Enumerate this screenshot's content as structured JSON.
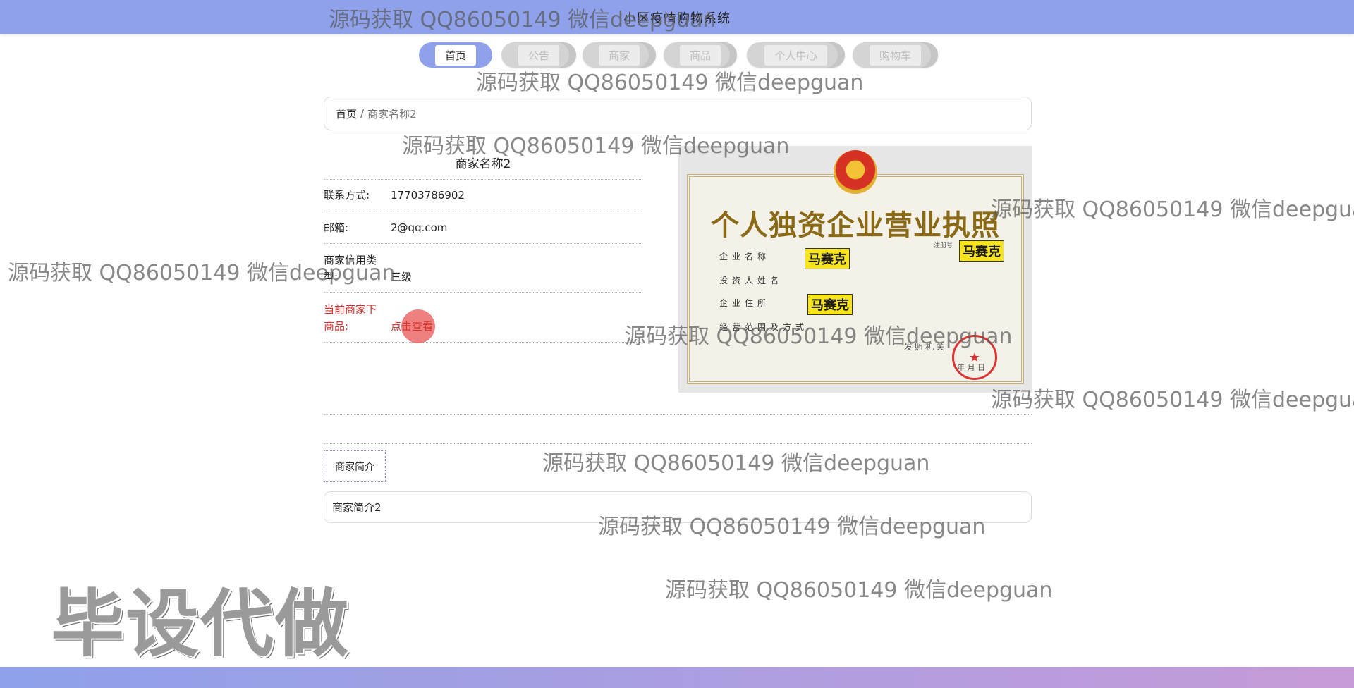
{
  "header": {
    "title": "小区疫情购物系统"
  },
  "nav": [
    {
      "label": "首页",
      "active": true
    },
    {
      "label": "公告",
      "active": false
    },
    {
      "label": "商家",
      "active": false
    },
    {
      "label": "商品",
      "active": false
    },
    {
      "label": "个人中心",
      "active": false
    },
    {
      "label": "购物车",
      "active": false
    }
  ],
  "breadcrumb": {
    "home": "首页",
    "separator": "/",
    "current": "商家名称2"
  },
  "merchant": {
    "name": "商家名称2",
    "contact_label": "联系方式:",
    "contact_value": "17703786902",
    "email_label": "邮箱:",
    "email_value": "2@qq.com",
    "credit_label": "商家信用类型:",
    "credit_value": "三级",
    "goods_label": "当前商家下商品:",
    "goods_link": "点击查看"
  },
  "license": {
    "title": "个人独资企业营业执照",
    "fields": [
      "企业名称",
      "投资人姓名",
      "企业住所",
      "经营范围及方式"
    ],
    "registration_label": "注册号",
    "issuer": "发照机关",
    "date": "年  月  日",
    "redaction_tag": "马赛克"
  },
  "intro": {
    "tab_label": "商家简介",
    "content": "商家简介2"
  },
  "watermarks": {
    "text": "源码获取 QQ86050149 微信deepguan",
    "banner": "毕设代做"
  },
  "colors": {
    "header": "#8ea1ea",
    "footer_start": "#8ea1ea",
    "footer_end": "#c79bd8",
    "alert": "#d9322c"
  }
}
